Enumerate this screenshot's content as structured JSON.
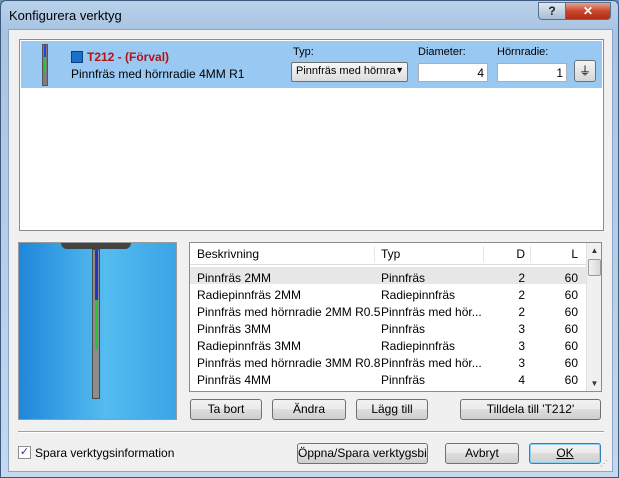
{
  "window": {
    "title": "Konfigurera verktyg",
    "help": "?",
    "close": "✕"
  },
  "tool": {
    "name": "T212 - (Förval)",
    "description": "Pinnfräs med hörnradie 4MM R1",
    "type_label": "Typ:",
    "type_value": "Pinnfräs med hörnra",
    "diameter_label": "Diameter:",
    "diameter_value": "4",
    "corner_label": "Hörnradie:",
    "corner_value": "1",
    "swatch_color": "#1b6fc9"
  },
  "list": {
    "columns": [
      "Beskrivning",
      "Typ",
      "D",
      "L"
    ],
    "rows": [
      [
        "Pinnfräs 2MM",
        "Pinnfräs",
        "2",
        "60"
      ],
      [
        "Radiepinnfräs 2MM",
        "Radiepinnfräs",
        "2",
        "60"
      ],
      [
        "Pinnfräs med hörnradie 2MM R0.5",
        "Pinnfräs med hör...",
        "2",
        "60"
      ],
      [
        "Pinnfräs 3MM",
        "Pinnfräs",
        "3",
        "60"
      ],
      [
        "Radiepinnfräs 3MM",
        "Radiepinnfräs",
        "3",
        "60"
      ],
      [
        "Pinnfräs med hörnradie 3MM R0.8",
        "Pinnfräs med hör...",
        "3",
        "60"
      ],
      [
        "Pinnfräs 4MM",
        "Pinnfräs",
        "4",
        "60"
      ]
    ]
  },
  "buttons": {
    "remove": "Ta bort",
    "change": "Ändra",
    "add": "Lägg till",
    "assign": "Tilldela till 'T212'",
    "open_save": "Öppna/Spara verktygsbibl",
    "cancel": "Avbryt",
    "ok": "OK"
  },
  "save_info": {
    "label": "Spara verktygsinformation",
    "checked": true
  }
}
